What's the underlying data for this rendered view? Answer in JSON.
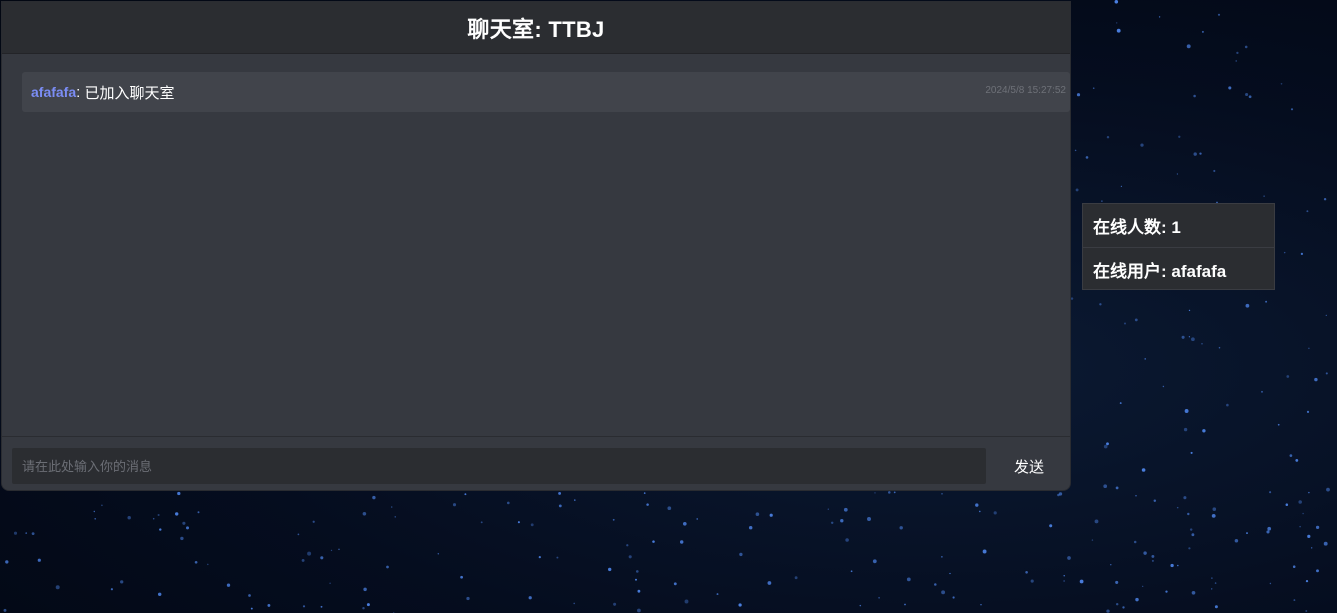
{
  "chat_room": {
    "title": "聊天室: TTBJ"
  },
  "messages": [
    {
      "user": "afafafa",
      "separator": ": ",
      "text": "已加入聊天室",
      "timestamp": "2024/5/8 15:27:52"
    }
  ],
  "composer": {
    "placeholder": "请在此处输入你的消息",
    "value": "",
    "send_label": "发送"
  },
  "online_panel": {
    "count_text": "在线人数: 1",
    "users_text": "在线用户: afafafa"
  },
  "colors": {
    "username_accent": "#7b8df5",
    "panel_background": "#363940",
    "header_background": "#2b2d31",
    "page_background": "#050d1f",
    "star": "#4a7fe0"
  }
}
